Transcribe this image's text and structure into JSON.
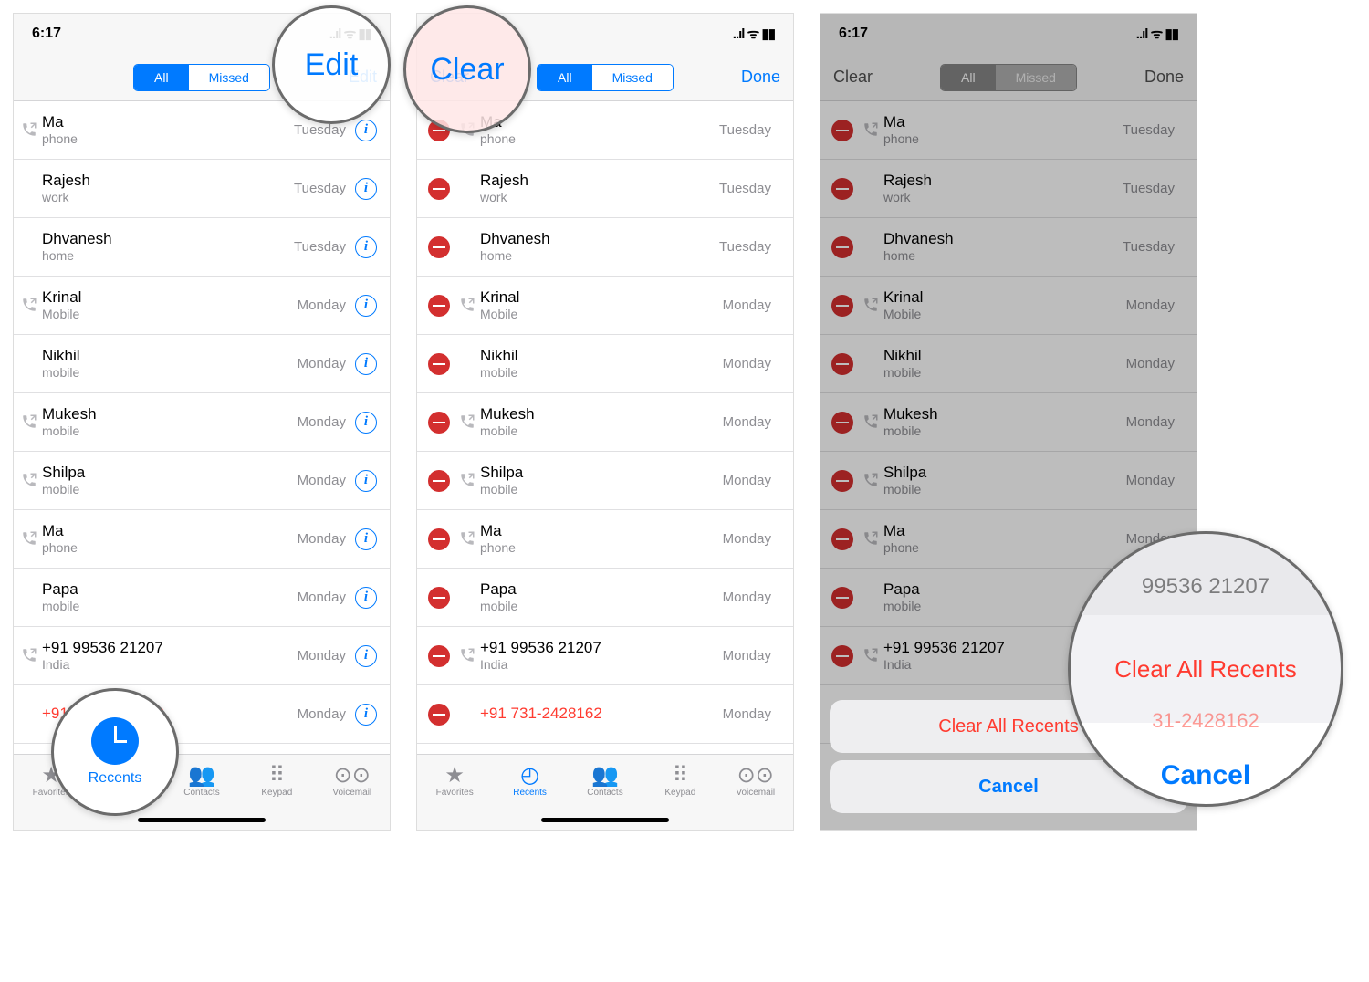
{
  "status": {
    "time": "6:17",
    "icons": "..ıl ᯤ ▮▮"
  },
  "seg": {
    "all": "All",
    "missed": "Missed"
  },
  "nav": {
    "edit": "Edit",
    "clear": "Clear",
    "done": "Done"
  },
  "calls": [
    {
      "name": "Ma",
      "sub": "phone",
      "day": "Tuesday",
      "out": true
    },
    {
      "name": "Rajesh",
      "sub": "work",
      "day": "Tuesday",
      "out": false
    },
    {
      "name": "Dhvanesh",
      "sub": "home",
      "day": "Tuesday",
      "out": false
    },
    {
      "name": "Krinal",
      "sub": "Mobile",
      "day": "Monday",
      "out": true
    },
    {
      "name": "Nikhil",
      "sub": "mobile",
      "day": "Monday",
      "out": false
    },
    {
      "name": "Mukesh",
      "sub": "mobile",
      "day": "Monday",
      "out": true
    },
    {
      "name": "Shilpa",
      "sub": "mobile",
      "day": "Monday",
      "out": true
    },
    {
      "name": "Ma",
      "sub": "phone",
      "day": "Monday",
      "out": true
    },
    {
      "name": "Papa",
      "sub": "mobile",
      "day": "Monday",
      "out": false
    },
    {
      "name": "+91 99536 21207",
      "sub": "India",
      "day": "Monday",
      "out": true
    },
    {
      "name": "+91 731-2428162",
      "sub": "",
      "day": "Monday",
      "out": false,
      "missed": true
    }
  ],
  "tabs": {
    "favorites": "Favorites",
    "recents": "Recents",
    "contacts": "Contacts",
    "keypad": "Keypad",
    "voicemail": "Voicemail"
  },
  "actionsheet": {
    "clear_all": "Clear All Recents",
    "cancel": "Cancel"
  },
  "callouts": {
    "edit": "Edit",
    "clear": "Clear",
    "recents": "Recents",
    "clear_all": "Clear All Recents",
    "cancel": "Cancel",
    "obscured_num": "99536 21207",
    "obscured_num2": "31-2428162"
  }
}
